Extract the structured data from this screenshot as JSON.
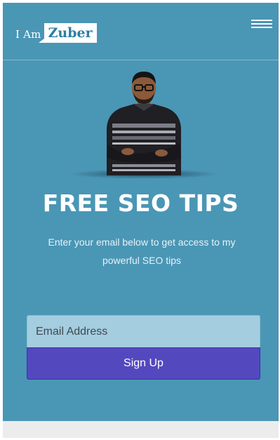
{
  "header": {
    "logo_prefix": "I Am",
    "logo_name": "Zuber"
  },
  "hero": {
    "headline": "FREE SEO TIPS",
    "subtext": "Enter your email below to get access to my powerful SEO tips"
  },
  "form": {
    "email_placeholder": "Email Address",
    "email_value": "",
    "submit_label": "Sign Up"
  },
  "colors": {
    "hero_background": "#4a96b5",
    "input_background": "#a4cddf",
    "button_background": "#5448bf",
    "logo_text": "#2d7fa2"
  },
  "icons": {
    "menu": "hamburger-menu-icon"
  }
}
